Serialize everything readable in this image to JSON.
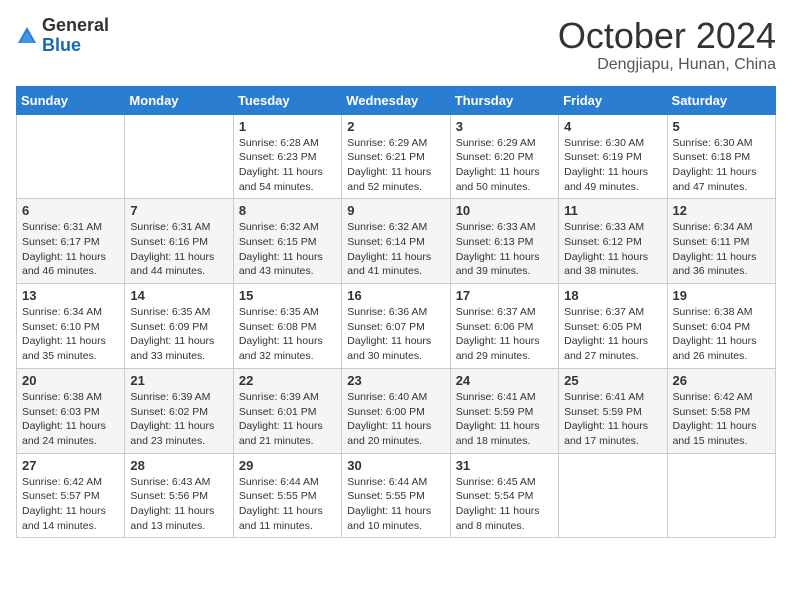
{
  "logo": {
    "general": "General",
    "blue": "Blue"
  },
  "header": {
    "month": "October 2024",
    "location": "Dengjiapu, Hunan, China"
  },
  "weekdays": [
    "Sunday",
    "Monday",
    "Tuesday",
    "Wednesday",
    "Thursday",
    "Friday",
    "Saturday"
  ],
  "weeks": [
    [
      {
        "day": "",
        "detail": ""
      },
      {
        "day": "",
        "detail": ""
      },
      {
        "day": "1",
        "detail": "Sunrise: 6:28 AM\nSunset: 6:23 PM\nDaylight: 11 hours and 54 minutes."
      },
      {
        "day": "2",
        "detail": "Sunrise: 6:29 AM\nSunset: 6:21 PM\nDaylight: 11 hours and 52 minutes."
      },
      {
        "day": "3",
        "detail": "Sunrise: 6:29 AM\nSunset: 6:20 PM\nDaylight: 11 hours and 50 minutes."
      },
      {
        "day": "4",
        "detail": "Sunrise: 6:30 AM\nSunset: 6:19 PM\nDaylight: 11 hours and 49 minutes."
      },
      {
        "day": "5",
        "detail": "Sunrise: 6:30 AM\nSunset: 6:18 PM\nDaylight: 11 hours and 47 minutes."
      }
    ],
    [
      {
        "day": "6",
        "detail": "Sunrise: 6:31 AM\nSunset: 6:17 PM\nDaylight: 11 hours and 46 minutes."
      },
      {
        "day": "7",
        "detail": "Sunrise: 6:31 AM\nSunset: 6:16 PM\nDaylight: 11 hours and 44 minutes."
      },
      {
        "day": "8",
        "detail": "Sunrise: 6:32 AM\nSunset: 6:15 PM\nDaylight: 11 hours and 43 minutes."
      },
      {
        "day": "9",
        "detail": "Sunrise: 6:32 AM\nSunset: 6:14 PM\nDaylight: 11 hours and 41 minutes."
      },
      {
        "day": "10",
        "detail": "Sunrise: 6:33 AM\nSunset: 6:13 PM\nDaylight: 11 hours and 39 minutes."
      },
      {
        "day": "11",
        "detail": "Sunrise: 6:33 AM\nSunset: 6:12 PM\nDaylight: 11 hours and 38 minutes."
      },
      {
        "day": "12",
        "detail": "Sunrise: 6:34 AM\nSunset: 6:11 PM\nDaylight: 11 hours and 36 minutes."
      }
    ],
    [
      {
        "day": "13",
        "detail": "Sunrise: 6:34 AM\nSunset: 6:10 PM\nDaylight: 11 hours and 35 minutes."
      },
      {
        "day": "14",
        "detail": "Sunrise: 6:35 AM\nSunset: 6:09 PM\nDaylight: 11 hours and 33 minutes."
      },
      {
        "day": "15",
        "detail": "Sunrise: 6:35 AM\nSunset: 6:08 PM\nDaylight: 11 hours and 32 minutes."
      },
      {
        "day": "16",
        "detail": "Sunrise: 6:36 AM\nSunset: 6:07 PM\nDaylight: 11 hours and 30 minutes."
      },
      {
        "day": "17",
        "detail": "Sunrise: 6:37 AM\nSunset: 6:06 PM\nDaylight: 11 hours and 29 minutes."
      },
      {
        "day": "18",
        "detail": "Sunrise: 6:37 AM\nSunset: 6:05 PM\nDaylight: 11 hours and 27 minutes."
      },
      {
        "day": "19",
        "detail": "Sunrise: 6:38 AM\nSunset: 6:04 PM\nDaylight: 11 hours and 26 minutes."
      }
    ],
    [
      {
        "day": "20",
        "detail": "Sunrise: 6:38 AM\nSunset: 6:03 PM\nDaylight: 11 hours and 24 minutes."
      },
      {
        "day": "21",
        "detail": "Sunrise: 6:39 AM\nSunset: 6:02 PM\nDaylight: 11 hours and 23 minutes."
      },
      {
        "day": "22",
        "detail": "Sunrise: 6:39 AM\nSunset: 6:01 PM\nDaylight: 11 hours and 21 minutes."
      },
      {
        "day": "23",
        "detail": "Sunrise: 6:40 AM\nSunset: 6:00 PM\nDaylight: 11 hours and 20 minutes."
      },
      {
        "day": "24",
        "detail": "Sunrise: 6:41 AM\nSunset: 5:59 PM\nDaylight: 11 hours and 18 minutes."
      },
      {
        "day": "25",
        "detail": "Sunrise: 6:41 AM\nSunset: 5:59 PM\nDaylight: 11 hours and 17 minutes."
      },
      {
        "day": "26",
        "detail": "Sunrise: 6:42 AM\nSunset: 5:58 PM\nDaylight: 11 hours and 15 minutes."
      }
    ],
    [
      {
        "day": "27",
        "detail": "Sunrise: 6:42 AM\nSunset: 5:57 PM\nDaylight: 11 hours and 14 minutes."
      },
      {
        "day": "28",
        "detail": "Sunrise: 6:43 AM\nSunset: 5:56 PM\nDaylight: 11 hours and 13 minutes."
      },
      {
        "day": "29",
        "detail": "Sunrise: 6:44 AM\nSunset: 5:55 PM\nDaylight: 11 hours and 11 minutes."
      },
      {
        "day": "30",
        "detail": "Sunrise: 6:44 AM\nSunset: 5:55 PM\nDaylight: 11 hours and 10 minutes."
      },
      {
        "day": "31",
        "detail": "Sunrise: 6:45 AM\nSunset: 5:54 PM\nDaylight: 11 hours and 8 minutes."
      },
      {
        "day": "",
        "detail": ""
      },
      {
        "day": "",
        "detail": ""
      }
    ]
  ]
}
